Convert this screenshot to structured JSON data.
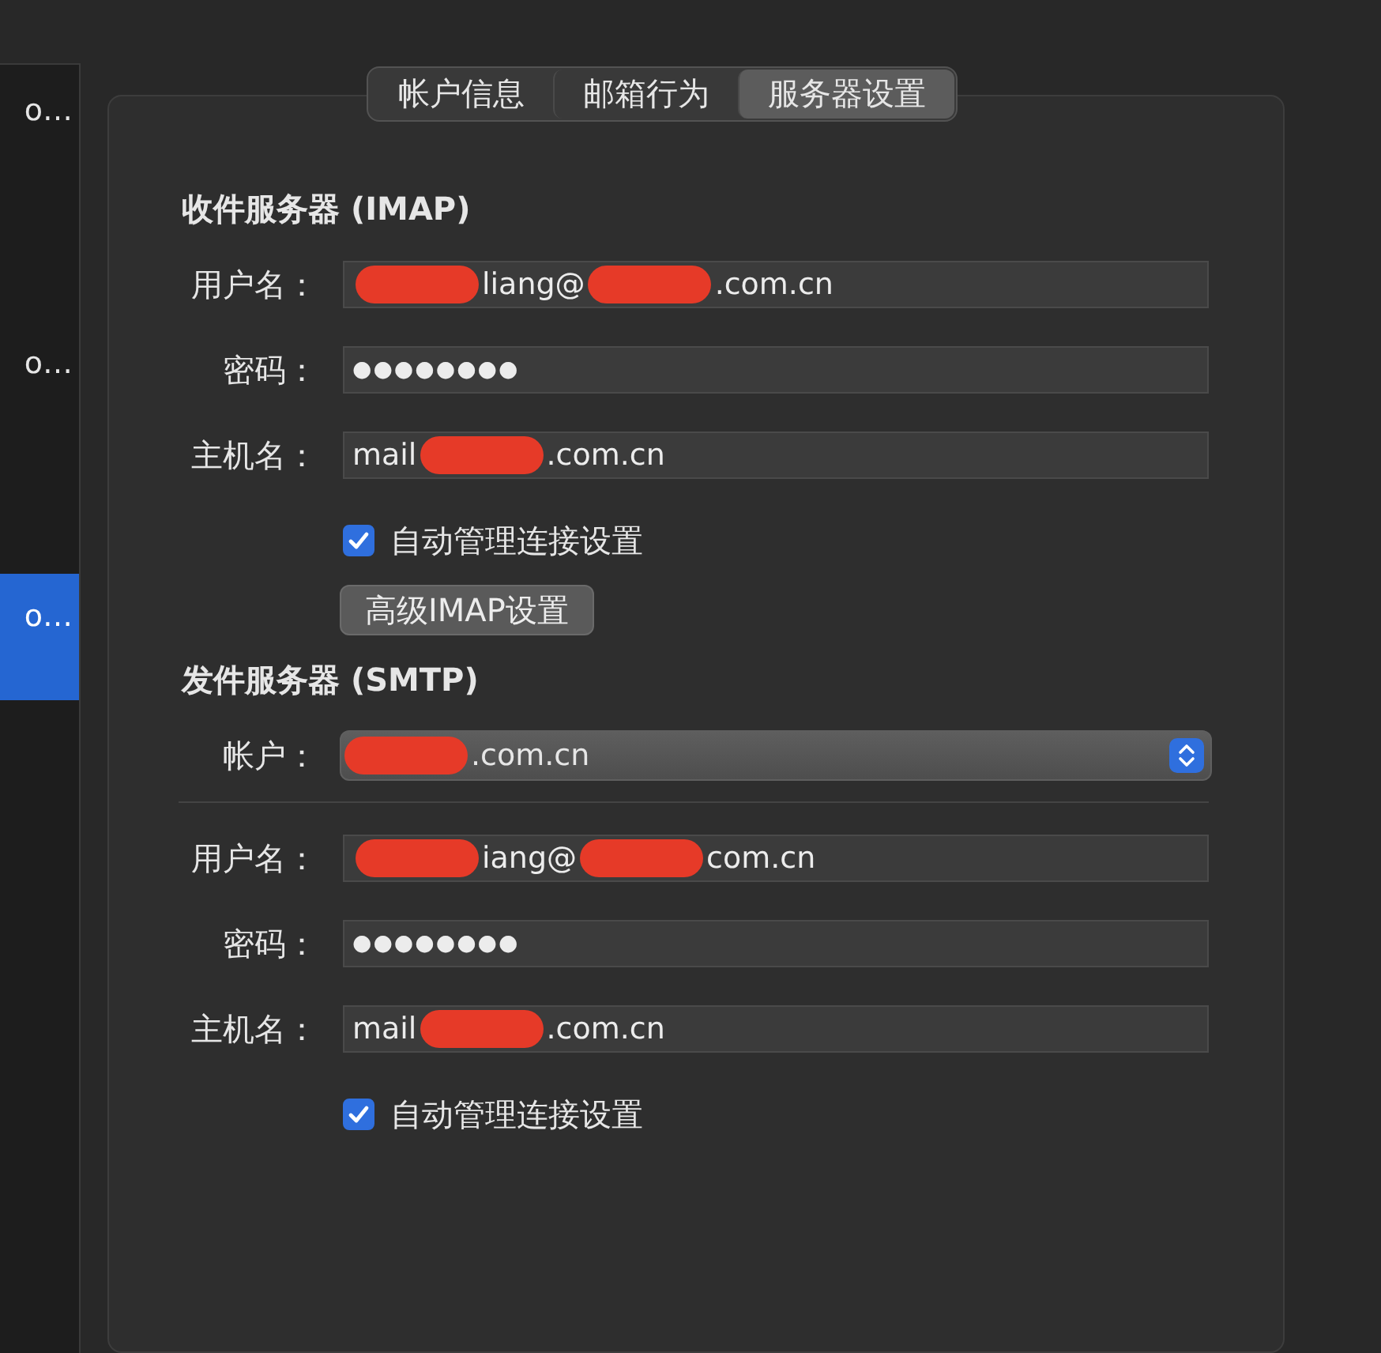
{
  "sidebar": {
    "items": [
      {
        "label": "o…",
        "selected": false
      },
      {
        "label": "o…",
        "selected": false
      },
      {
        "label": "o…",
        "selected": true
      }
    ]
  },
  "tabs": [
    {
      "label": "帐户信息",
      "selected": false
    },
    {
      "label": "邮箱行为",
      "selected": false
    },
    {
      "label": "服务器设置",
      "selected": true
    }
  ],
  "sections": [
    {
      "title": "收件服务器 (IMAP)",
      "rows": [
        {
          "kind": "text",
          "label": "用户名：",
          "value_parts": [
            {
              "kind": "redacted"
            },
            {
              "kind": "text",
              "text": "liang@"
            },
            {
              "kind": "redacted"
            },
            {
              "kind": "text",
              "text": ".com.cn"
            }
          ]
        },
        {
          "kind": "password",
          "label": "密码：",
          "value": "●●●●●●●●"
        },
        {
          "kind": "text",
          "label": "主机名：",
          "value_parts": [
            {
              "kind": "text",
              "text": "mail"
            },
            {
              "kind": "redacted"
            },
            {
              "kind": "text",
              "text": ".com.cn"
            }
          ]
        },
        {
          "kind": "checkbox",
          "label": "自动管理连接设置",
          "checked": true
        },
        {
          "kind": "button",
          "label": "高级IMAP设置"
        }
      ]
    },
    {
      "title": "发件服务器 (SMTP)",
      "rows": [
        {
          "kind": "popup",
          "label": "帐户：",
          "value_parts": [
            {
              "kind": "redacted"
            },
            {
              "kind": "text",
              "text": ".com.cn"
            }
          ]
        },
        {
          "kind": "divider"
        },
        {
          "kind": "text",
          "label": "用户名：",
          "value_parts": [
            {
              "kind": "redacted"
            },
            {
              "kind": "text",
              "text": "iang@"
            },
            {
              "kind": "redacted"
            },
            {
              "kind": "text",
              "text": "com.cn"
            }
          ]
        },
        {
          "kind": "password",
          "label": "密码：",
          "value": "●●●●●●●●"
        },
        {
          "kind": "text",
          "label": "主机名：",
          "value_parts": [
            {
              "kind": "text",
              "text": "mail"
            },
            {
              "kind": "redacted"
            },
            {
              "kind": "text",
              "text": ".com.cn"
            }
          ]
        },
        {
          "kind": "checkbox",
          "label": "自动管理连接设置",
          "checked": true
        }
      ]
    }
  ]
}
